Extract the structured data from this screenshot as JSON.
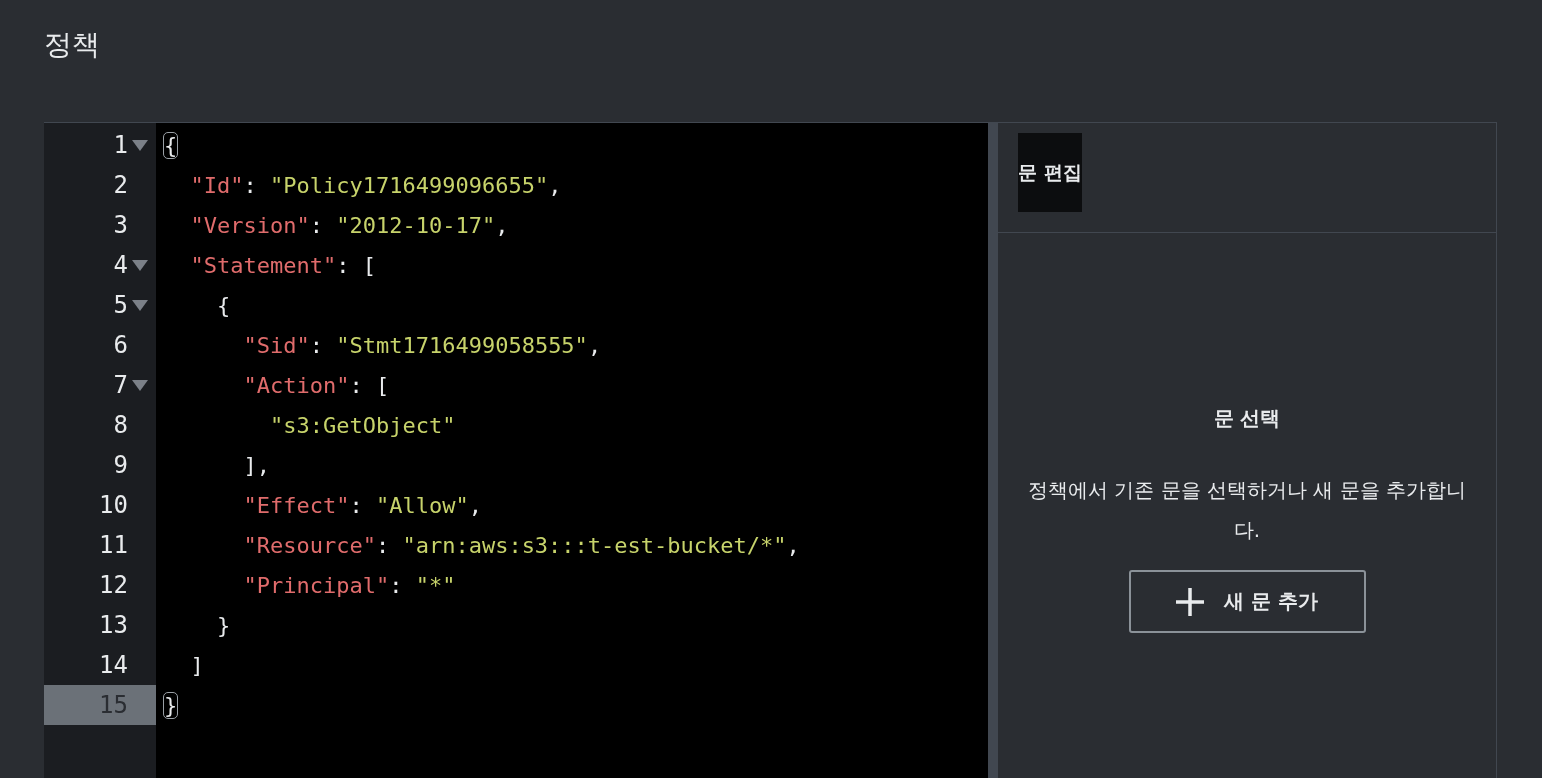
{
  "page": {
    "title": "정책"
  },
  "editor": {
    "lines": [
      {
        "number": "1",
        "fold": true,
        "selected": false,
        "tokens": [
          {
            "kind": "bracket",
            "text": "{"
          }
        ]
      },
      {
        "number": "2",
        "fold": false,
        "selected": false,
        "tokens": [
          {
            "kind": "key",
            "text": "  \"Id\""
          },
          {
            "kind": "punct",
            "text": ": "
          },
          {
            "kind": "str",
            "text": "\"Policy1716499096655\""
          },
          {
            "kind": "punct",
            "text": ","
          }
        ]
      },
      {
        "number": "3",
        "fold": false,
        "selected": false,
        "tokens": [
          {
            "kind": "key",
            "text": "  \"Version\""
          },
          {
            "kind": "punct",
            "text": ": "
          },
          {
            "kind": "str",
            "text": "\"2012-10-17\""
          },
          {
            "kind": "punct",
            "text": ","
          }
        ]
      },
      {
        "number": "4",
        "fold": true,
        "selected": false,
        "tokens": [
          {
            "kind": "key",
            "text": "  \"Statement\""
          },
          {
            "kind": "punct",
            "text": ": ["
          }
        ]
      },
      {
        "number": "5",
        "fold": true,
        "selected": false,
        "tokens": [
          {
            "kind": "punct",
            "text": "    {"
          }
        ]
      },
      {
        "number": "6",
        "fold": false,
        "selected": false,
        "tokens": [
          {
            "kind": "key",
            "text": "      \"Sid\""
          },
          {
            "kind": "punct",
            "text": ": "
          },
          {
            "kind": "str",
            "text": "\"Stmt1716499058555\""
          },
          {
            "kind": "punct",
            "text": ","
          }
        ]
      },
      {
        "number": "7",
        "fold": true,
        "selected": false,
        "tokens": [
          {
            "kind": "key",
            "text": "      \"Action\""
          },
          {
            "kind": "punct",
            "text": ": ["
          }
        ]
      },
      {
        "number": "8",
        "fold": false,
        "selected": false,
        "tokens": [
          {
            "kind": "str",
            "text": "        \"s3:GetObject\""
          }
        ]
      },
      {
        "number": "9",
        "fold": false,
        "selected": false,
        "tokens": [
          {
            "kind": "punct",
            "text": "      ],"
          }
        ]
      },
      {
        "number": "10",
        "fold": false,
        "selected": false,
        "tokens": [
          {
            "kind": "key",
            "text": "      \"Effect\""
          },
          {
            "kind": "punct",
            "text": ": "
          },
          {
            "kind": "str",
            "text": "\"Allow\""
          },
          {
            "kind": "punct",
            "text": ","
          }
        ]
      },
      {
        "number": "11",
        "fold": false,
        "selected": false,
        "tokens": [
          {
            "kind": "key",
            "text": "      \"Resource\""
          },
          {
            "kind": "punct",
            "text": ": "
          },
          {
            "kind": "str",
            "text": "\"arn:aws:s3:::t-est-bucket/*\""
          },
          {
            "kind": "punct",
            "text": ","
          }
        ]
      },
      {
        "number": "12",
        "fold": false,
        "selected": false,
        "tokens": [
          {
            "kind": "key",
            "text": "      \"Principal\""
          },
          {
            "kind": "punct",
            "text": ": "
          },
          {
            "kind": "str",
            "text": "\"*\""
          }
        ]
      },
      {
        "number": "13",
        "fold": false,
        "selected": false,
        "tokens": [
          {
            "kind": "punct",
            "text": "    }"
          }
        ]
      },
      {
        "number": "14",
        "fold": false,
        "selected": false,
        "tokens": [
          {
            "kind": "punct",
            "text": "  ]"
          }
        ]
      },
      {
        "number": "15",
        "fold": false,
        "selected": true,
        "tokens": [
          {
            "kind": "bracket",
            "text": "}"
          }
        ]
      }
    ]
  },
  "side_panel": {
    "header": "문 편집",
    "heading": "문 선택",
    "description": "정책에서 기존 문을 선택하거나 새 문을 추가합니다.",
    "add_button": "새 문 추가"
  }
}
